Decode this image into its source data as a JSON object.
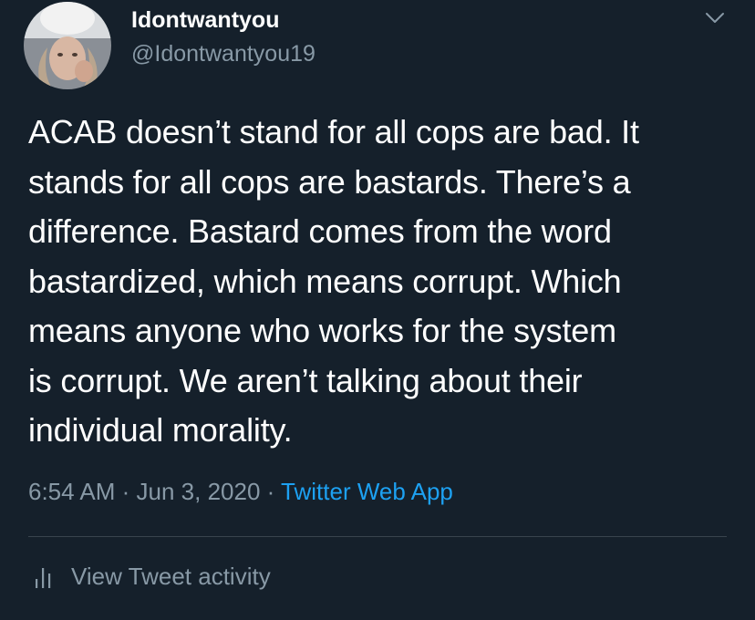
{
  "user": {
    "display_name": "Idontwantyou",
    "handle": "@Idontwantyou19"
  },
  "tweet": {
    "text_lines": [
      "ACAB doesn’t stand for all cops are bad. It",
      "stands for all cops are bastards. There’s a",
      "difference. Bastard comes from the word",
      "bastardized, which means corrupt. Which",
      "means anyone who works for the system",
      "is corrupt. We aren’t talking about their",
      "individual morality."
    ]
  },
  "meta": {
    "time": "6:54 AM",
    "separator": " · ",
    "date": "Jun 3, 2020",
    "source": "Twitter Web App"
  },
  "actions": {
    "activity_label": "View Tweet activity"
  },
  "icons": {
    "menu": "chevron-down-icon",
    "activity": "bar-chart-icon"
  },
  "colors": {
    "background": "#15202b",
    "primary_text": "#ffffff",
    "secondary_text": "#8899a6",
    "link": "#1da1f2",
    "divider": "#38444d"
  }
}
